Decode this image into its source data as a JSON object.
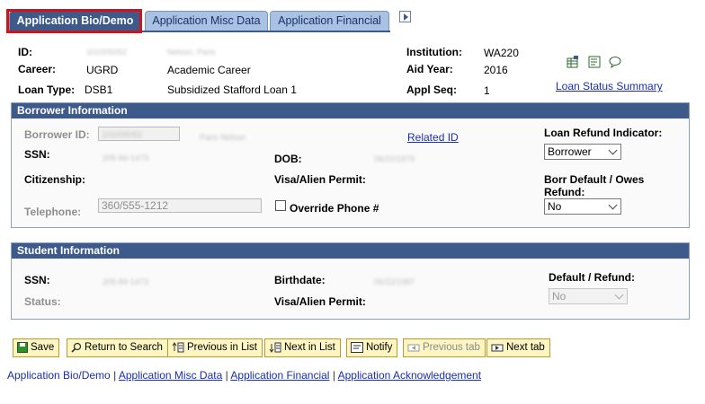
{
  "tabs": {
    "bio": "Application Bio/Demo",
    "misc": "Application Misc Data",
    "financial": "Application Financial"
  },
  "header": {
    "id_label": "ID:",
    "id_value": "101005052",
    "name_value": "Nelson, Paris",
    "career_label": "Career:",
    "career_value": "UGRD",
    "career_desc": "Academic Career",
    "loan_type_label": "Loan Type:",
    "loan_type_value": "DSB1",
    "loan_type_desc": "Subsidized Stafford Loan 1",
    "institution_label": "Institution:",
    "institution_value": "WA220",
    "aid_year_label": "Aid Year:",
    "aid_year_value": "2016",
    "appl_seq_label": "Appl Seq:",
    "appl_seq_value": "1",
    "loan_status_link": "Loan Status Summary"
  },
  "borrower": {
    "title": "Borrower Information",
    "borrower_id_label": "Borrower ID:",
    "borrower_id_value": "101005052",
    "borrower_name": "Paris Nelson",
    "related_id_link": "Related ID",
    "ssn_label": "SSN:",
    "ssn_value": "205-84-1473",
    "dob_label": "DOB:",
    "dob_value": "06/22/1979",
    "citizenship_label": "Citizenship:",
    "visa_label": "Visa/Alien Permit:",
    "telephone_label": "Telephone:",
    "telephone_value": "360/555-1212",
    "override_phone_label": "Override Phone #",
    "refund_indicator_label": "Loan Refund Indicator:",
    "refund_indicator_value": "Borrower",
    "default_label_1": "Borr Default / Owes",
    "default_label_2": "Refund:",
    "default_value": "No"
  },
  "student": {
    "title": "Student Information",
    "ssn_label": "SSN:",
    "ssn_value": "205-84-1473",
    "birthdate_label": "Birthdate:",
    "birthdate_value": "06/22/1987",
    "status_label": "Status:",
    "visa_label": "Visa/Alien Permit:",
    "default_refund_label": "Default / Refund:",
    "default_refund_value": "No"
  },
  "toolbar": {
    "save": "Save",
    "return_to_search": "Return to Search",
    "previous_in_list": "Previous in List",
    "next_in_list": "Next in List",
    "notify": "Notify",
    "previous_tab": "Previous tab",
    "next_tab": "Next tab"
  },
  "footer_links": {
    "bio": "Application Bio/Demo",
    "misc": "Application Misc Data",
    "financial": "Application Financial",
    "acknowledgement": "Application Acknowledgement",
    "separator": "|"
  },
  "colors": {
    "accent": "#3d5a8a",
    "tab_inactive": "#a9c1e3",
    "button_bg": "#fdf5c2",
    "highlight": "#d0121b",
    "link": "#1a2fa8"
  }
}
